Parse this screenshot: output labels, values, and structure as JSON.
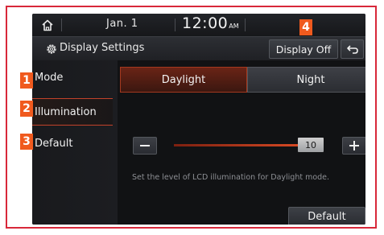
{
  "status": {
    "date": "Jan. 1",
    "time": "12:00",
    "ampm": "AM"
  },
  "titlebar": {
    "title": "Display Settings",
    "display_off": "Display Off"
  },
  "menu": {
    "items": [
      {
        "label": "Mode",
        "badge": "1"
      },
      {
        "label": "Illumination",
        "badge": "2",
        "active": true
      },
      {
        "label": "Default",
        "badge": "3"
      }
    ]
  },
  "tabs": {
    "daylight": "Daylight",
    "night": "Night",
    "selected": "Daylight"
  },
  "illumination": {
    "value": "10",
    "level_fraction": 1.0,
    "hint": "Set the level of LCD illumination for Daylight mode."
  },
  "default_button": "Default",
  "badge4": "4",
  "colors": {
    "accent": "#c2422a",
    "badge": "#f05a1e",
    "frame": "#d8283a"
  },
  "icons": [
    "home-icon",
    "gear-icon",
    "back-arrow-icon",
    "minus-icon",
    "plus-icon"
  ]
}
